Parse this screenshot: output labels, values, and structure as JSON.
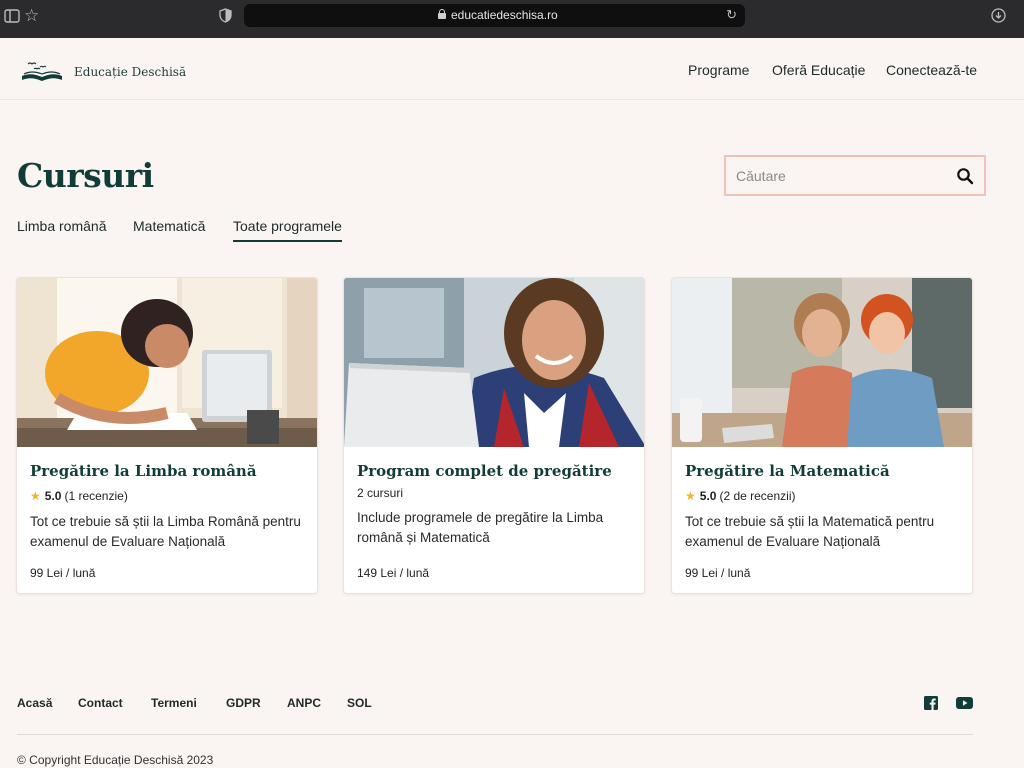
{
  "browser": {
    "url": "educatiedeschisa.ro"
  },
  "header": {
    "brand": "Educație Deschisă",
    "nav": [
      {
        "label": "Programe"
      },
      {
        "label": "Oferă Educație"
      },
      {
        "label": "Conectează-te"
      }
    ]
  },
  "page": {
    "title": "Cursuri",
    "search_placeholder": "Căutare",
    "tabs": [
      {
        "label": "Limba română",
        "active": false
      },
      {
        "label": "Matematică",
        "active": false
      },
      {
        "label": "Toate programele",
        "active": true
      }
    ]
  },
  "courses": [
    {
      "title": "Pregătire la Limba română",
      "rating": "5.0",
      "reviews": "(1 recenzie)",
      "description": "Tot ce trebuie să știi la Limba Română pentru examenul de Evaluare Națională",
      "price": "99 Lei / lună"
    },
    {
      "title": "Program complet de pregătire",
      "subtitle": "2 cursuri",
      "description": "Include programele de pregătire la Limba română și Matematică",
      "price": "149 Lei / lună"
    },
    {
      "title": "Pregătire la Matematică",
      "rating": "5.0",
      "reviews": "(2 de recenzii)",
      "description": "Tot ce trebuie să știi la Matematică pentru examenul de Evaluare Națională",
      "price": "99 Lei / lună"
    }
  ],
  "footer": {
    "links": [
      {
        "label": "Acasă"
      },
      {
        "label": "Contact"
      },
      {
        "label": "Termeni"
      },
      {
        "label": "GDPR"
      },
      {
        "label": "ANPC"
      },
      {
        "label": "SOL"
      }
    ],
    "copyright": "© Copyright Educație Deschisă 2023",
    "social_icons": [
      "facebook-icon",
      "youtube-icon"
    ]
  },
  "colors": {
    "brand": "#123c37",
    "background": "#faf5f2",
    "search_border": "#ecc5b6",
    "star": "#f4b32a"
  }
}
